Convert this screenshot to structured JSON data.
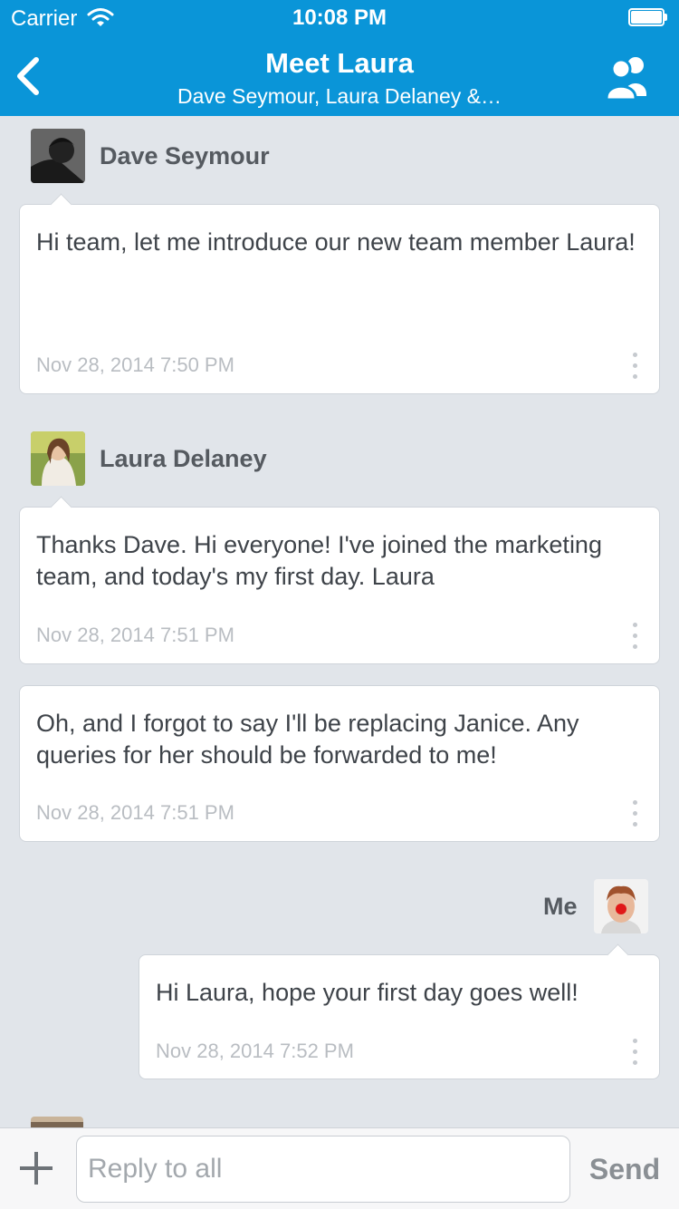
{
  "status_bar": {
    "carrier": "Carrier",
    "time": "10:08 PM",
    "battery_level": 1.0
  },
  "nav": {
    "title": "Meet Laura",
    "subtitle": "Dave Seymour, Laura Delaney &…",
    "back_icon": "chevron-left-icon",
    "participants_icon": "people-icon"
  },
  "messages": [
    {
      "author": "Dave Seymour",
      "text": "Hi team, let me introduce our new team member Laura!",
      "time": "Nov 28, 2014 7:50 PM"
    },
    {
      "author": "Laura Delaney",
      "text": "Thanks Dave. Hi everyone! I've joined the marketing team, and today's my first day. Laura",
      "time": "Nov 28, 2014 7:51 PM"
    },
    {
      "author": "",
      "text": "Oh, and I forgot to say I'll be replacing Janice. Any queries for her should be forwarded to me!",
      "time": "Nov 28, 2014 7:51 PM"
    },
    {
      "author": "Me",
      "text": "Hi Laura, hope your first day goes well!",
      "time": "Nov 28, 2014 7:52 PM"
    }
  ],
  "compose": {
    "placeholder": "Reply to all",
    "value": "",
    "send_label": "Send",
    "add_icon": "plus-icon"
  },
  "colors": {
    "header": "#0a95d8",
    "background": "#e1e5ea",
    "bubble": "#ffffff",
    "timestamp": "#b9bdc2",
    "name": "#555a60",
    "send": "#8a8f94"
  }
}
